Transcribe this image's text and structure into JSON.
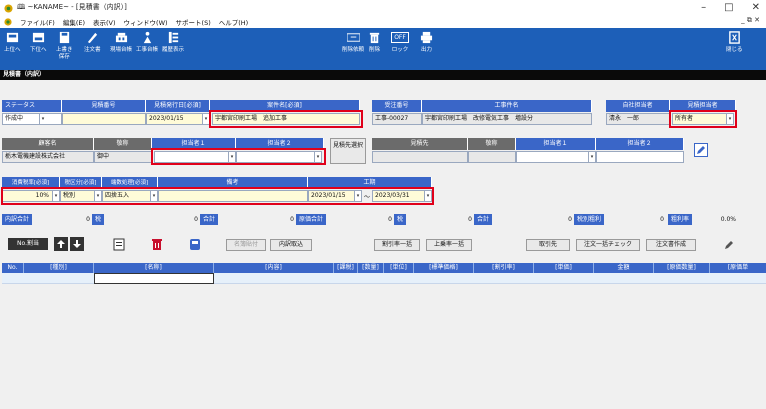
{
  "window": {
    "title": "🕮 ~KANAME~ - [見積書（内訳）]",
    "minimize": "–",
    "maximize": "□",
    "close": "✕"
  },
  "menu": {
    "items": [
      "ファイル(F)",
      "編集(E)",
      "表示(V)",
      "ウィンドウ(W)",
      "サポート(S)",
      "ヘルプ(H)"
    ],
    "mdi_controls": "_ ⧉ ✕"
  },
  "toolbar": {
    "up": "上位へ",
    "down": "下位へ",
    "overwrite_line1": "上書き",
    "overwrite_line2": "保存",
    "order_form": "注文書",
    "site_ledger": "現場台帳",
    "construction_ledger": "工事台帳",
    "history": "履歴表示",
    "delete_request": "削除依頼",
    "delete": "削除",
    "lock": "ロック",
    "lock_state": "OFF",
    "output": "出力",
    "close": "閉じる"
  },
  "section_title": "見積書（内訳）",
  "row1": {
    "status_label": "ステータス",
    "estimate_no_label": "見積番号",
    "issue_date_label": "見積発行日[必須]",
    "project_label": "案件名[必須]",
    "order_no_label": "受注番号",
    "work_name_label": "工事件名",
    "own_staff_label": "自社担当者",
    "estimate_staff_label": "見積担当者",
    "status_value": "作成中",
    "estimate_no_value": "",
    "issue_date_value": "2023/01/15",
    "project_value": "宇都宮印刷工場　追加工事",
    "order_no_value": "工事-00027",
    "work_name_value": "宇都宮印刷工場　改修電気工事　増設分",
    "own_staff_value": "清永　一郎",
    "estimate_staff_value": "所有者"
  },
  "row2": {
    "customer_label": "顧客名",
    "honorific_label": "敬称",
    "person1_label": "担当者１",
    "person2_label": "担当者２",
    "recipient_select": "見積先選択",
    "recipient_label": "見積先",
    "honorific2_label": "敬称",
    "person1b_label": "担当者１",
    "person2b_label": "担当者２",
    "customer_value": "栃木電機建設株式会社",
    "honorific_value": "御中",
    "person1_value": "",
    "person2_value": ""
  },
  "row3": {
    "tax_rate_label": "消費税率[必須]",
    "tax_class_label": "税区分[必須]",
    "rounding_label": "端数処理[必須]",
    "remarks_label": "備考",
    "period_label": "工期",
    "tax_rate_value": "10%",
    "tax_class_value": "税別",
    "rounding_value": "四捨五入",
    "remarks_value": "",
    "period_start": "2023/01/15",
    "tilde": "～",
    "period_end": "2023/03/31"
  },
  "totals": {
    "breakdown_label": "内訳合計",
    "breakdown_value": "0",
    "tax_label": "税",
    "tax_value": "0",
    "total_label": "合計",
    "total_value": "0",
    "cost_total_label": "原価合計",
    "cost_total_value": "0",
    "tax2_label": "税",
    "tax2_value": "0",
    "total2_label": "合計",
    "total2_value": "0",
    "gross_profit_label": "税別粗利",
    "gross_profit_value": "0",
    "margin_label": "粗利率",
    "margin_value": "0.0%"
  },
  "actions": {
    "renumber": "No.割当",
    "product_quote": "名簿貼付",
    "import": "内訳取込",
    "discount_all": "割引率一括",
    "markup_all": "上乗率一括",
    "supplier": "取引先",
    "order_check": "注文一括チェック",
    "order_create": "注文書作成"
  },
  "grid": {
    "columns": [
      "No.",
      "[種別]",
      "[名称]",
      "[内容]",
      "[課税]",
      "[数量]",
      "[単位]",
      "[標準価格]",
      "[割引率]",
      "[単価]",
      "金額",
      "[原価数量]",
      "[原価単"
    ]
  }
}
